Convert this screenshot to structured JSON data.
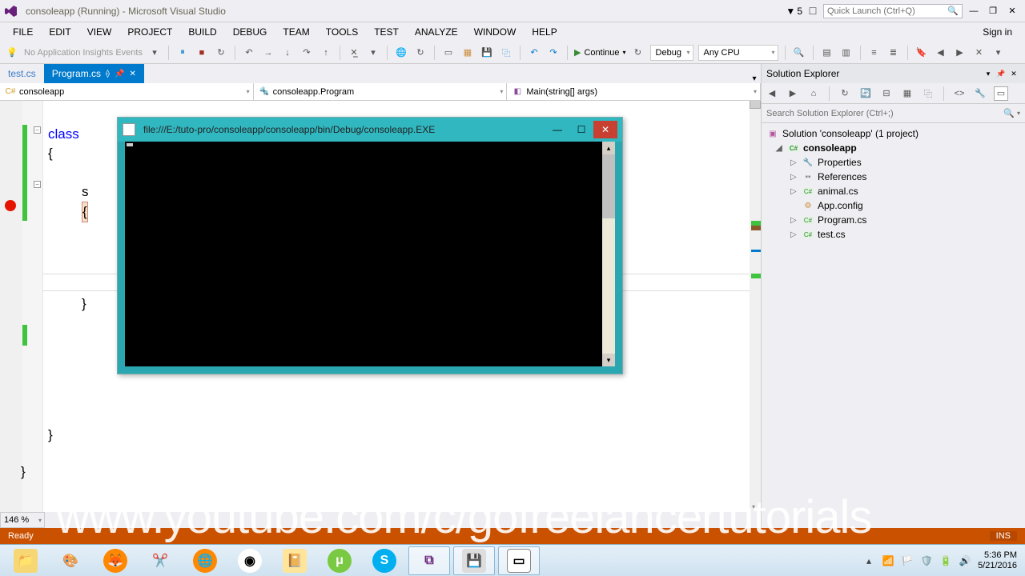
{
  "window": {
    "title": "consoleapp (Running) - Microsoft Visual Studio"
  },
  "notif_count": "5",
  "quicklaunch": {
    "placeholder": "Quick Launch (Ctrl+Q)"
  },
  "signin": "Sign in",
  "menu": [
    "FILE",
    "EDIT",
    "VIEW",
    "PROJECT",
    "BUILD",
    "DEBUG",
    "TEAM",
    "TOOLS",
    "TEST",
    "ANALYZE",
    "WINDOW",
    "HELP"
  ],
  "toolbar": {
    "no_events": "No Application Insights Events",
    "continue": "Continue",
    "cfg": "Debug",
    "plat": "Any CPU"
  },
  "tabs": {
    "inactive": "test.cs",
    "active": "Program.cs"
  },
  "nav": {
    "ns": "consoleapp",
    "cls": "consoleapp.Program",
    "mth": "Main(string[] args)"
  },
  "code": {
    "l1a": "class",
    "l1b": "",
    "l2": "{",
    "l3": "s",
    "l4": "{",
    "l5": "}",
    "l6": "}",
    "l7": "}"
  },
  "console": {
    "title": "file:///E:/tuto-pro/consoleapp/consoleapp/bin/Debug/consoleapp.EXE"
  },
  "zoom": "146 %",
  "sol": {
    "title": "Solution Explorer",
    "search": "Search Solution Explorer (Ctrl+;)",
    "root": "Solution 'consoleapp' (1 project)",
    "proj": "consoleapp",
    "items": [
      "Properties",
      "References",
      "animal.cs",
      "App.config",
      "Program.cs",
      "test.cs"
    ]
  },
  "status": {
    "ready": "Ready",
    "ins": "INS"
  },
  "watermark": "www.youtube.com/c/gofreelancertutorials",
  "tray": {
    "time": "5:36 PM",
    "date": "5/21/2016"
  }
}
